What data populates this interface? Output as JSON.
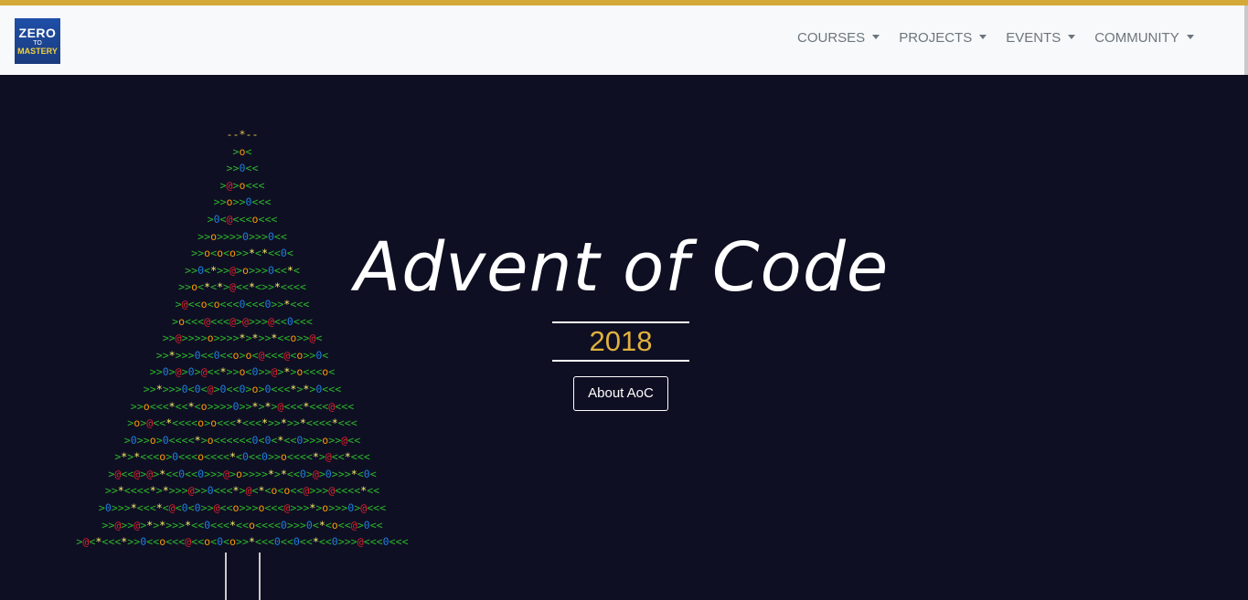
{
  "navbar": {
    "logo": {
      "line1": "ZERO",
      "line2": "TO",
      "line3": "MASTERY"
    },
    "items": [
      {
        "label": "COURSES"
      },
      {
        "label": "PROJECTS"
      },
      {
        "label": "EVENTS"
      },
      {
        "label": "COMMUNITY"
      }
    ]
  },
  "hero": {
    "title": "Advent of Code",
    "year": "2018",
    "button_label": "About AoC"
  },
  "tree": {
    "rows": [
      "--*--",
      ">o<",
      ">>0<<",
      ">@>o<<<",
      ">>o>>0<<<",
      ">0<@<<<o<<<",
      ">>o>>>>0>>>0<<",
      ">>o<o<o>>*<*<<0<",
      ">>0<*>>@>o>>>0<<*<",
      ">>o<*<*>@<<*<>>*<<<<",
      ">@<<o<o<<<0<<<0>>*<<<",
      ">o<<<@<<<@>@>>>@<<0<<<",
      ">>@>>>>o>>>>*>*>>*<<o>>@<",
      ">>*>>>0<<0<<o>o<@<<<@<o>>0<",
      ">>0>@>0>@<<*>>o<0>>@>*>o<<<o<",
      ">>*>>>0<0<@>0<<0>o>0<<<*>*>0<<<",
      ">>o<<<*<<*<o>>>>0>>*>*>@<<<*<<<@<<<",
      ">o>@<<*<<<<o>o<<<*<<<*>>*>>*<<<<*<<<",
      ">0>>o>0<<<<*>o<<<<<<0<0<*<<0>>>o>>@<<",
      ">*>*<<<o>0<<<o<<<<*<0<<0>>o<<<<*>@<<*<<<",
      ">@<<@>@>*<<0<<0>>>@>o>>>>*>*<<0>@>0>>>*<0<",
      ">>*<<<<*>*>>>@>>0<<<*>@<*<o<o<<@>>>@<<<<*<<",
      ">0>>>*<<<*<@<0<0>>@<<o>>>o<<<@>>>*>o>>>0>@<<<",
      ">>@>>@>*>*>>>*<<0<<<*<<o<<<<0>>>0<*<o<<@>0<<",
      ">@<*<<<*>>0<<o<<<@<<o<0<o>>*<<<0<<0<<*<<0>>>@<<<0<<<"
    ]
  }
}
